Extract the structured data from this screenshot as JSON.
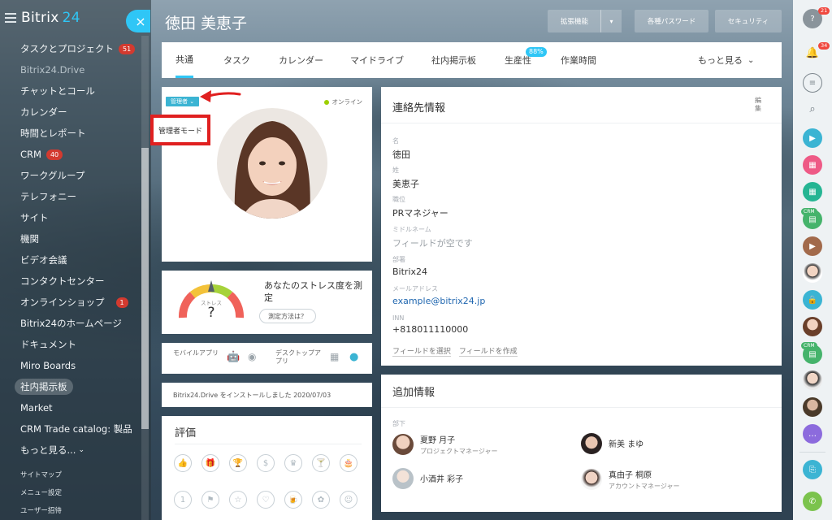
{
  "app": {
    "logo": "Bitrix",
    "logo_num": "24",
    "close_icon": "×"
  },
  "sidebar": {
    "items": [
      {
        "label": "タスクとプロジェクト",
        "badge": "51"
      },
      {
        "label": "Bitrix24.Drive",
        "dim": true
      },
      {
        "label": "チャットとコール"
      },
      {
        "label": "カレンダー"
      },
      {
        "label": "時間とレポート"
      },
      {
        "label": "CRM",
        "badge": "40"
      },
      {
        "label": "ワークグループ"
      },
      {
        "label": "テレフォニー"
      },
      {
        "label": "サイト"
      },
      {
        "label": "機関"
      },
      {
        "label": "ビデオ会議"
      },
      {
        "label": "コンタクトセンター"
      },
      {
        "label": "オンラインショップ",
        "badge": "1"
      },
      {
        "label": "Bitrix24のホームページ"
      },
      {
        "label": "ドキュメント"
      },
      {
        "label": "Miro Boards"
      },
      {
        "label": "社内掲示板",
        "active": true
      },
      {
        "label": "Market"
      },
      {
        "label": "CRM Trade catalog: 製品"
      },
      {
        "label": "もっと見る...",
        "caret": "⌄"
      }
    ],
    "footer": [
      "サイトマップ",
      "メニュー設定",
      "ユーザー招待"
    ]
  },
  "header": {
    "title": "徳田 美恵子",
    "btn_extended": "拡張機能",
    "btn_passwords": "各種パスワード",
    "btn_security": "セキュリティ",
    "caret": "▾"
  },
  "tabs": [
    {
      "label": "共通",
      "active": true
    },
    {
      "label": "タスク"
    },
    {
      "label": "カレンダー"
    },
    {
      "label": "マイドライブ"
    },
    {
      "label": "社内掲示板"
    },
    {
      "label": "生産性",
      "badge": "88%"
    },
    {
      "label": "作業時間"
    },
    {
      "label": "もっと見る",
      "caret": "⌄"
    }
  ],
  "profile": {
    "admin_tag": "管理者 ⌄",
    "status": "オンライン",
    "admin_mode_label": "管理者モード",
    "annotation_color": "#e02020"
  },
  "stress": {
    "gauge_label": "ストレス",
    "gauge_value": "?",
    "title": "あなたのストレス度を測定",
    "how_button": "測定方法は？"
  },
  "apps": {
    "mobile_label": "モバイルアプリ",
    "desktop_label": "デスクトップアプリ"
  },
  "install_note": "Bitrix24.Drive をインストールしました 2020/07/03",
  "rating": {
    "title": "評価"
  },
  "contact": {
    "title": "連絡先情報",
    "edit": "編集",
    "fields": [
      {
        "label": "名",
        "value": "徳田"
      },
      {
        "label": "姓",
        "value": "美恵子"
      },
      {
        "label": "職位",
        "value": "PRマネジャー"
      },
      {
        "label": "ミドルネーム",
        "value": "フィールドが空です",
        "empty": true
      },
      {
        "label": "部署",
        "value": "Bitrix24"
      },
      {
        "label": "メールアドレス",
        "value": "example@bitrix24.jp",
        "link": true
      },
      {
        "label": "INN",
        "value": "+818011110000"
      }
    ],
    "select_field": "フィールドを選択",
    "create_field": "フィールドを作成"
  },
  "additional": {
    "title": "追加情報",
    "subordinates_label": "部下",
    "people": [
      {
        "name": "夏野 月子",
        "position": "プロジェクトマネージャー"
      },
      {
        "name": "新美 まゆ",
        "position": ""
      },
      {
        "name": "小酒井 彩子",
        "position": ""
      },
      {
        "name": "真由子 桐原",
        "position": "アカウントマネージャー"
      }
    ]
  },
  "rightbar": {
    "help_badge": "21",
    "bell_badge": "34",
    "crm_tag": "CRM"
  },
  "colors": {
    "accent": "#2fc6f6",
    "badge_red": "#d33a2f",
    "admin_tag": "#3bb4d3"
  }
}
